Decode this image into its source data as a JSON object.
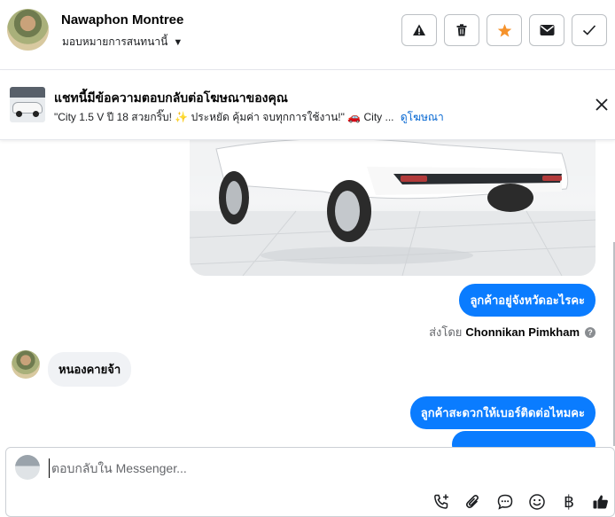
{
  "header": {
    "name": "Nawaphon Montree",
    "assign_label": "มอบหมายการสนทนานี้",
    "actions": [
      "warning-icon",
      "trash-icon",
      "star-icon",
      "mail-icon",
      "check-icon"
    ]
  },
  "ad": {
    "title": "แชทนี้มีข้อความตอบกลับต่อโฆษณาของคุณ",
    "snippet": "\"City 1.5 V ปี 18 สวยกริ๊บ! ✨ ประหยัด คุ้มค่า จบทุกการใช้งาน!\" 🚗 City ...",
    "link": "ดูโฆษณา"
  },
  "messages": {
    "out_1": "ลูกค้าอยู่จังหวัดอะไรคะ",
    "sent_by_prefix": "ส่งโดย",
    "sent_by_name": "Chonnikan Pimkham",
    "info": "?",
    "in_1": "หนองคายจ้า",
    "out_2": "ลูกค้าสะดวกให้เบอร์ติดต่อไหมคะ"
  },
  "composer": {
    "placeholder": "ตอบกลับใน Messenger...",
    "currency_symbol": "฿"
  },
  "colors": {
    "accent": "#0a7cff",
    "link": "#0064d1",
    "incoming_bubble": "#f0f2f5"
  }
}
